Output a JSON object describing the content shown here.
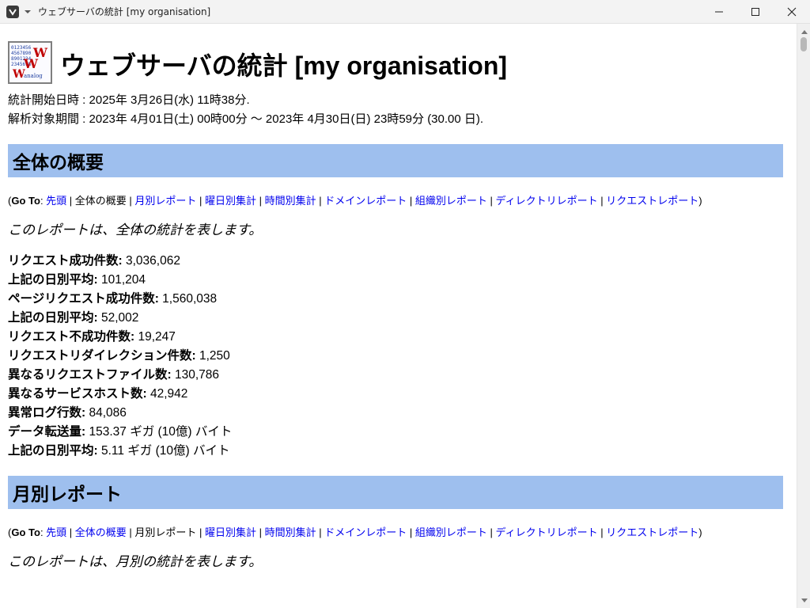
{
  "window": {
    "title": "ウェブサーバの統計 [my organisation]",
    "icon": "vivaldi-icon"
  },
  "page": {
    "title": "ウェブサーバの統計 [my organisation]",
    "logo_text": [
      "0123456",
      "4567890",
      "8901234",
      "2345678",
      "WWW",
      "analog"
    ],
    "generated": "統計開始日時 : 2025年 3月26日(水) 11時38分.",
    "period": "解析対象期間 : 2023年 4月01日(土) 00時00分 〜 2023年 4月30日(日) 23時59分 (30.00 日)."
  },
  "goto": {
    "open": "(",
    "label": "Go To",
    "colon": ": ",
    "close": ")",
    "sep": " | ",
    "items": [
      "先頭",
      "全体の概要",
      "月別レポート",
      "曜日別集計",
      "時間別集計",
      "ドメインレポート",
      "組織別レポート",
      "ディレクトリレポート",
      "リクエストレポート"
    ]
  },
  "general": {
    "heading": "全体の概要",
    "description": "このレポートは、全体の統計を表します。",
    "stats": [
      {
        "label": "リクエスト成功件数:",
        "value": "3,036,062"
      },
      {
        "label": "上記の日別平均:",
        "value": "101,204"
      },
      {
        "label": "ページリクエスト成功件数:",
        "value": "1,560,038"
      },
      {
        "label": "上記の日別平均:",
        "value": "52,002"
      },
      {
        "label": "リクエスト不成功件数:",
        "value": "19,247"
      },
      {
        "label": "リクエストリダイレクション件数:",
        "value": "1,250"
      },
      {
        "label": "異なるリクエストファイル数:",
        "value": "130,786"
      },
      {
        "label": "異なるサービスホスト数:",
        "value": "42,942"
      },
      {
        "label": "異常ログ行数:",
        "value": "84,086"
      },
      {
        "label": "データ転送量:",
        "value": "153.37 ギガ (10億) バイト"
      },
      {
        "label": "上記の日別平均:",
        "value": "5.11 ギガ (10億) バイト"
      }
    ]
  },
  "monthly": {
    "heading": "月別レポート",
    "description": "このレポートは、月別の統計を表します。"
  },
  "colors": {
    "section_bg": "#9ebfee",
    "link": "#0000ee"
  }
}
